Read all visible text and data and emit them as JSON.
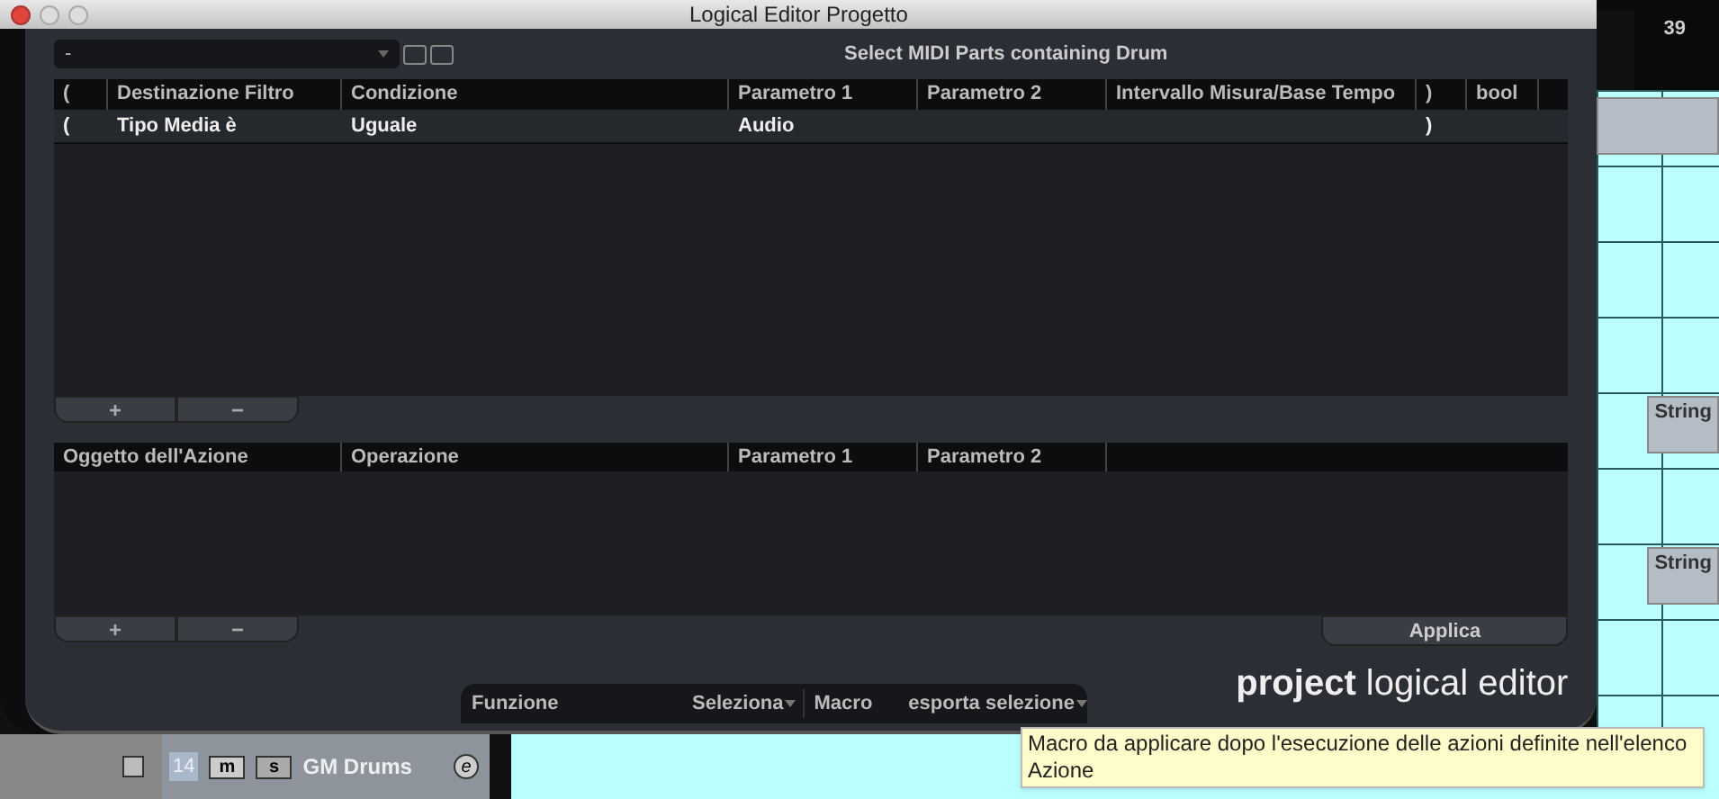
{
  "window": {
    "title": "Logical Editor Progetto"
  },
  "preset": {
    "value": "-",
    "name": "Select MIDI Parts containing Drum"
  },
  "filter_table": {
    "columns": [
      "(",
      "Destinazione Filtro",
      "Condizione",
      "Parametro 1",
      "Parametro 2",
      "Intervallo Misura/Base Tempo",
      ")",
      "bool"
    ],
    "rows": [
      {
        "open": "(",
        "target": "Tipo Media è",
        "condition": "Uguale",
        "param1": "Audio",
        "close": ")"
      }
    ],
    "buttons": [
      "+",
      "−"
    ]
  },
  "action_table": {
    "columns": [
      "Oggetto dell'Azione",
      "Operazione",
      "Parametro 1",
      "Parametro 2"
    ],
    "buttons": [
      "+",
      "−"
    ]
  },
  "apply_button": "Applica",
  "function_bar": {
    "function_label": "Funzione",
    "function_value": "Seleziona",
    "macro_label": "Macro",
    "macro_value": "esporta selezione"
  },
  "logo": {
    "bold": "project",
    "light": "logical editor"
  },
  "tooltip": "Macro da applicare dopo l'esecuzione delle azioni definite nell'elenco Azione",
  "arrange": {
    "ruler": "39",
    "parts": [
      "String",
      "String"
    ]
  },
  "track": {
    "number": "14",
    "mute": "m",
    "solo": "s",
    "name": "GM Drums",
    "edit": "e"
  }
}
